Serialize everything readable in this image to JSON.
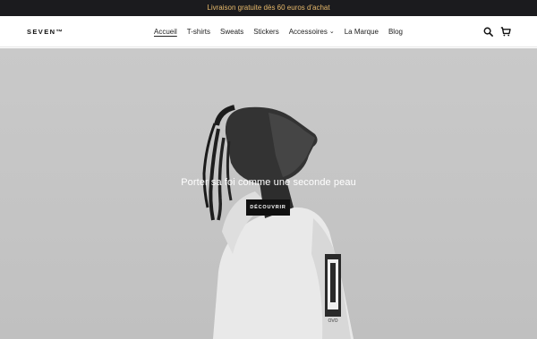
{
  "announcement": {
    "text": "Livraison gratuite dès 60 euros d'achat"
  },
  "header": {
    "logo": "SEVEN™",
    "nav": [
      {
        "label": "Accueil",
        "active": true
      },
      {
        "label": "T-shirts"
      },
      {
        "label": "Sweats"
      },
      {
        "label": "Stickers"
      },
      {
        "label": "Accessoires",
        "has_dropdown": true
      },
      {
        "label": "La Marque"
      },
      {
        "label": "Blog"
      }
    ],
    "icons": [
      "search-icon",
      "cart-icon"
    ]
  },
  "hero": {
    "title": "Porter sa foi comme une seconde peau",
    "button_label": "DÉCOUVRIR"
  },
  "colors": {
    "announcement_bg": "#1b1b1e",
    "announcement_text": "#e7b96b",
    "button_bg": "#111111",
    "hero_bg": "#c6c6c6"
  }
}
